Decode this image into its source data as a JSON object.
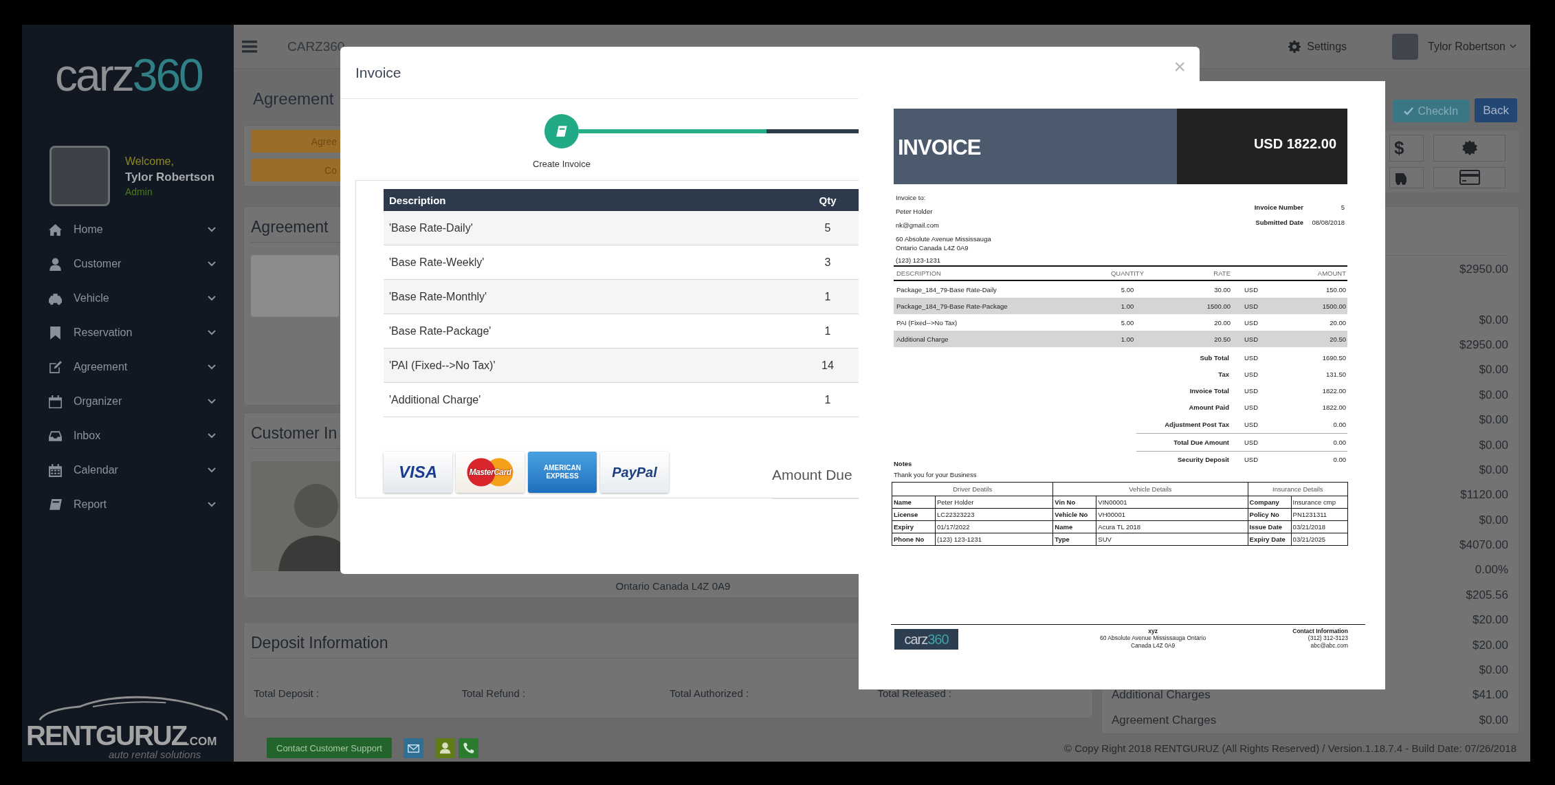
{
  "sidebar": {
    "logo": {
      "text": "carz",
      "number": "360"
    },
    "user": {
      "greeting": "Welcome,",
      "name": "Tylor Robertson",
      "role": "Admin"
    },
    "nav": [
      {
        "label": "Home",
        "kind": "home"
      },
      {
        "label": "Customer",
        "kind": "user"
      },
      {
        "label": "Vehicle",
        "kind": "car"
      },
      {
        "label": "Reservation",
        "kind": "bookmark"
      },
      {
        "label": "Agreement",
        "kind": "edit"
      },
      {
        "label": "Organizer",
        "kind": "calendar"
      },
      {
        "label": "Inbox",
        "kind": "inbox"
      },
      {
        "label": "Calendar",
        "kind": "grid"
      },
      {
        "label": "Report",
        "kind": "book"
      }
    ],
    "brand": {
      "name": "RENTGURUZ",
      "suffix": ".COM",
      "tagline": "auto rental solutions"
    }
  },
  "topbar": {
    "app_name": "CARZ360",
    "settings": "Settings",
    "user_name": "Tylor Robertson"
  },
  "page": {
    "title": "Agreement",
    "action_buttons": [
      "Agree",
      "Co"
    ],
    "agreement_card": {
      "title": "Agreement"
    },
    "customer_card": {
      "title": "Customer In",
      "address": "Ontario Canada L4Z 0A9"
    },
    "deposit_card": {
      "title": "Deposit Information",
      "totals": [
        "Total Deposit :",
        "Total Refund :",
        "Total Authorized :",
        "Total Released :"
      ]
    },
    "buttons": {
      "checkin": "CheckIn",
      "back": "Back"
    },
    "quick_actions": [
      {
        "kind": "dollar",
        "symbol": "$"
      },
      {
        "kind": "badge"
      },
      {
        "kind": "car"
      },
      {
        "kind": "card"
      }
    ],
    "charges": [
      {
        "value": "$2950.00"
      },
      {
        "value": "$0.00"
      },
      {
        "value": "$2950.00"
      },
      {
        "value": "$0.00"
      },
      {
        "value": "$0.00"
      },
      {
        "value": "$0.00"
      },
      {
        "value": "$0.00"
      },
      {
        "value": "$0.00"
      },
      {
        "value": "$1120.00"
      },
      {
        "value": "$0.00"
      },
      {
        "value": "$4070.00"
      },
      {
        "value": "0.00%"
      },
      {
        "value": "$205.56"
      },
      {
        "value": "$20.00"
      },
      {
        "value": "$20.00"
      },
      {
        "value": "$0.00"
      },
      {
        "label": "Additional Charges",
        "value": "$41.00"
      },
      {
        "label": "Agreement Charges",
        "value": "$0.00"
      }
    ]
  },
  "footer": {
    "support": "Contact Customer Support",
    "copyright": "© Copy Right 2018 RENTGURUZ (All Rights Reserved) / Version.1.18.7.4 - Build Date: 07/26/2018"
  },
  "modal": {
    "title": "Invoice",
    "close": "×",
    "step": "Create Invoice",
    "columns": [
      "Description",
      "Qty"
    ],
    "rows": [
      [
        "'Base Rate-Daily'",
        "5"
      ],
      [
        "'Base Rate-Weekly'",
        "3"
      ],
      [
        "'Base Rate-Monthly'",
        "1"
      ],
      [
        "'Base Rate-Package'",
        "1"
      ],
      [
        "'PAI (Fixed-->No Tax)'",
        "14"
      ],
      [
        "'Additional Charge'",
        "1"
      ]
    ],
    "payment_methods": [
      {
        "kind": "visa",
        "label": "VISA"
      },
      {
        "kind": "mastercard",
        "label": "MasterCard"
      },
      {
        "kind": "amex",
        "label": "AMERICAN EXPRESS"
      },
      {
        "kind": "paypal",
        "label": "PayPal"
      }
    ],
    "amount_due": "Amount Due"
  },
  "invoice": {
    "title": "INVOICE",
    "total": "USD 1822.00",
    "bill_to": {
      "heading": "Invoice to:",
      "name": "Peter  Holder",
      "email": "nk@gmail.com",
      "address": [
        "60 Absolute Avenue  Mississauga",
        "Ontario Canada L4Z 0A9"
      ],
      "phone": "(123) 123-1231"
    },
    "meta": [
      {
        "label": "Invoice Number",
        "value": "5"
      },
      {
        "label": "Submitted Date",
        "value": "08/08/2018"
      }
    ],
    "columns": [
      "DESCRIPTION",
      "QUANTITY",
      "RATE",
      "AMOUNT"
    ],
    "lines": [
      {
        "description": "Package_184_79-Base Rate-Daily",
        "quantity": "5.00",
        "rate": "30.00",
        "currency": "USD",
        "amount": "150.00"
      },
      {
        "description": "Package_184_79-Base Rate-Package",
        "quantity": "1.00",
        "rate": "1500.00",
        "currency": "USD",
        "amount": "1500.00"
      },
      {
        "description": "PAI (Fixed-->No Tax)",
        "quantity": "5.00",
        "rate": "20.00",
        "currency": "USD",
        "amount": "20.00"
      },
      {
        "description": "Additional Charge",
        "quantity": "1.00",
        "rate": "20.50",
        "currency": "USD",
        "amount": "20.50"
      }
    ],
    "totals": [
      {
        "label": "Sub Total",
        "currency": "USD",
        "value": "1690.50",
        "ruled": false
      },
      {
        "label": "Tax",
        "currency": "USD",
        "value": "131.50",
        "ruled": false
      },
      {
        "label": "Invoice Total",
        "currency": "USD",
        "value": "1822.00",
        "ruled": false
      },
      {
        "label": "Amount Paid",
        "currency": "USD",
        "value": "1822.00",
        "ruled": false
      },
      {
        "label": "Adjustment Post Tax",
        "currency": "USD",
        "value": "0.00",
        "ruled": true
      },
      {
        "label": "Total Due Amount",
        "currency": "USD",
        "value": "0.00",
        "ruled": true
      },
      {
        "label": "Security Deposit",
        "currency": "USD",
        "value": "0.00",
        "ruled": false
      }
    ],
    "notes_heading": "Notes",
    "notes": "Thank you for your Business",
    "details": [
      {
        "heading": "Driver Deatils",
        "rows": [
          [
            "Name",
            "Peter Holder"
          ],
          [
            "License",
            "LC22323223"
          ],
          [
            "Expiry",
            "01/17/2022"
          ],
          [
            "Phone No",
            "(123) 123-1231"
          ]
        ]
      },
      {
        "heading": "Vehicle Details",
        "rows": [
          [
            "Vin No",
            "VIN00001"
          ],
          [
            "Vehicle No",
            "VH00001"
          ],
          [
            "Name",
            "Acura TL 2018"
          ],
          [
            "Type",
            "SUV"
          ]
        ]
      },
      {
        "heading": "Insurance Details",
        "rows": [
          [
            "Company",
            "Insurance cmp"
          ],
          [
            "Policy No",
            "PN1231311"
          ],
          [
            "Issue Date",
            "03/21/2018"
          ],
          [
            "Expiry Date",
            "03/21/2025"
          ]
        ]
      }
    ],
    "footer": {
      "logo": {
        "text": "carz",
        "number": "360"
      },
      "company": "xyz",
      "address": [
        "60 Absolute Avenue Mississauga Ontario",
        "Canada L4Z 0A9"
      ],
      "contact_heading": "Contact Information",
      "contact": [
        "(312) 312-3123",
        "abc@abc.com"
      ]
    }
  }
}
